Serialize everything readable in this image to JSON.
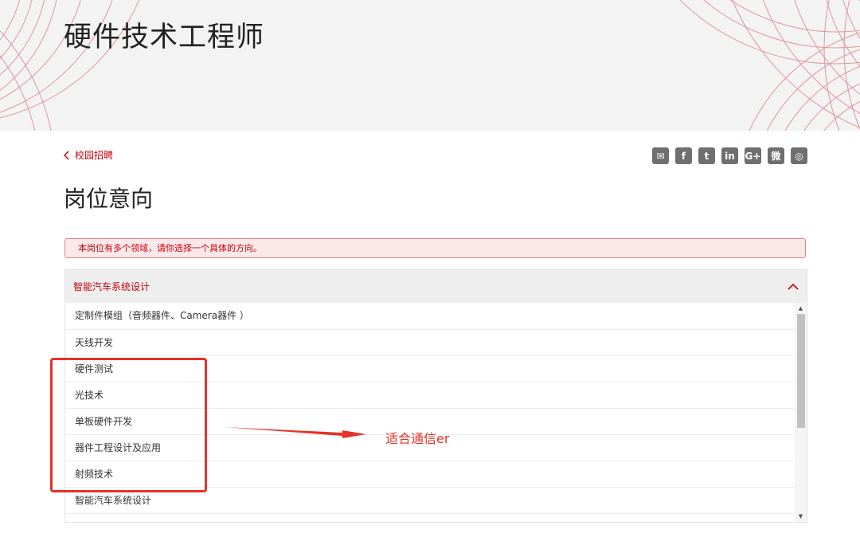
{
  "hero": {
    "title": "硬件技术工程师"
  },
  "nav": {
    "back_label": "校园招聘"
  },
  "share": {
    "icons": [
      {
        "name": "email-icon",
        "glyph": "✉"
      },
      {
        "name": "facebook-icon",
        "glyph": "f"
      },
      {
        "name": "twitter-icon",
        "glyph": "t"
      },
      {
        "name": "linkedin-icon",
        "glyph": "in"
      },
      {
        "name": "google-plus-icon",
        "glyph": "G+"
      },
      {
        "name": "weibo-icon",
        "glyph": "微"
      },
      {
        "name": "wechat-icon",
        "glyph": "◎"
      }
    ]
  },
  "section": {
    "title": "岗位意向"
  },
  "alert": {
    "text": "本岗位有多个领域，请你选择一个具体的方向。"
  },
  "dropdown": {
    "selected": "智能汽车系统设计",
    "options": [
      "定制件模组（音频器件、Camera器件 ）",
      "天线开发",
      "硬件测试",
      "光技术",
      "单板硬件开发",
      "器件工程设计及应用",
      "射频技术",
      "智能汽车系统设计"
    ]
  },
  "annotation": {
    "text": "适合通信er"
  },
  "colors": {
    "accent": "#c7000b",
    "annotation": "#e63227"
  }
}
